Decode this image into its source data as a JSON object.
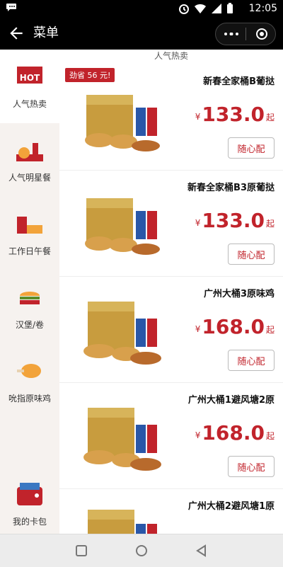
{
  "status_bar": {
    "time": "12:05"
  },
  "header": {
    "title": "菜单"
  },
  "sidebar": {
    "items": [
      {
        "label": "人气热卖",
        "icon": "hot-icon"
      },
      {
        "label": "人气明星餐",
        "icon": "meal-icon"
      },
      {
        "label": "工作日午餐",
        "icon": "lunch-icon"
      },
      {
        "label": "汉堡/卷",
        "icon": "burger-icon"
      },
      {
        "label": "吮指原味鸡",
        "icon": "chicken-icon"
      },
      {
        "label": "我的卡包",
        "icon": "wallet-icon"
      }
    ]
  },
  "main": {
    "section_title": "人气热卖",
    "items": [
      {
        "name": "新春全家桶B葡挞",
        "currency": "¥",
        "price": "133.0",
        "suffix": "起",
        "button": "随心配",
        "badge": "劲省 56 元!"
      },
      {
        "name": "新春全家桶B3原葡挞",
        "currency": "¥",
        "price": "133.0",
        "suffix": "起",
        "button": "随心配"
      },
      {
        "name": "广州大桶3原味鸡",
        "currency": "¥",
        "price": "168.0",
        "suffix": "起",
        "button": "随心配"
      },
      {
        "name": "广州大桶1避风塘2原",
        "currency": "¥",
        "price": "168.0",
        "suffix": "起",
        "button": "随心配"
      },
      {
        "name": "广州大桶2避风塘1原"
      }
    ]
  },
  "colors": {
    "accent": "#c1232b",
    "sidebar_bg": "#f6f2ef",
    "topbar_bg": "#000000"
  }
}
